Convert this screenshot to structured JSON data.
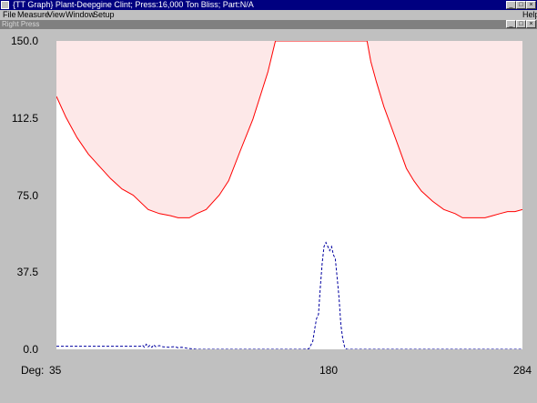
{
  "window": {
    "title": "{TT Graph} Plant-Deepgine Clint; Press:16,000 Ton Bliss; Part:N/A",
    "menu": [
      "File",
      "Measure",
      "View",
      "Window",
      "Setup"
    ],
    "help_label": "Help",
    "child_title": "Right Press"
  },
  "axis": {
    "x_prefix": "Deg:",
    "x_ticks": [
      "35",
      "180",
      "284"
    ]
  },
  "chart_data": {
    "type": "line",
    "x_range": [
      35,
      284
    ],
    "ylim": [
      0,
      150
    ],
    "y_ticks": [
      "150.0",
      "112.5",
      "75.0",
      "37.5",
      "0.0"
    ],
    "grid": false,
    "legend": "none",
    "colors": {
      "limit": "#ff0000",
      "limit_fill": "#fde8e8",
      "signal": "#0000a0"
    },
    "series": [
      {
        "style": "solid-red-limit-shaded-above",
        "x": [
          35,
          40,
          46,
          52,
          58,
          64,
          70,
          76,
          84,
          90,
          96,
          100,
          106,
          110,
          115,
          122,
          127,
          133,
          140,
          148,
          152,
          156,
          160,
          168,
          175,
          180,
          186,
          192,
          198,
          201,
          203,
          206,
          210,
          216,
          222,
          226,
          230,
          236,
          242,
          248,
          252,
          256,
          260,
          264,
          268,
          272,
          276,
          280,
          284
        ],
        "values": [
          123,
          113,
          103,
          95,
          89,
          83,
          78,
          75,
          68,
          66,
          65,
          64,
          64,
          66,
          68,
          75,
          82,
          96,
          112,
          135,
          150,
          150,
          150,
          150,
          150,
          150,
          150,
          150,
          150,
          150,
          140,
          130,
          118,
          103,
          88,
          82,
          77,
          72,
          68,
          66,
          64,
          64,
          64,
          64,
          65,
          66,
          67,
          67,
          68
        ]
      },
      {
        "style": "dashed-blue-signal",
        "x": [
          35,
          50,
          70,
          80,
          81,
          82,
          83,
          84,
          85,
          86,
          87,
          88,
          90,
          92,
          95,
          98,
          100,
          102,
          105,
          110,
          120,
          130,
          140,
          150,
          160,
          167,
          170,
          172,
          173,
          174,
          175,
          176,
          177,
          178,
          179,
          180,
          181,
          182,
          183,
          184,
          185,
          186,
          187,
          188,
          189,
          190,
          192,
          195,
          200,
          210,
          220,
          230,
          240,
          250,
          260,
          270,
          280,
          284
        ],
        "values": [
          1.5,
          1.5,
          1.5,
          1.5,
          2.0,
          1.0,
          2.5,
          1.2,
          2.0,
          1.0,
          2.2,
          1.3,
          1.8,
          1.2,
          1.0,
          1.3,
          0.8,
          1.0,
          0.5,
          0.0,
          0.0,
          0.0,
          0.0,
          0.0,
          0.0,
          0.0,
          0.3,
          4.0,
          10.0,
          15.0,
          17.0,
          30.0,
          42.0,
          50.0,
          52.0,
          50.0,
          48.0,
          50.0,
          46.0,
          44.0,
          35.0,
          25.0,
          12.0,
          5.0,
          1.0,
          0.0,
          0.0,
          0.0,
          0.0,
          0.0,
          0.0,
          0.0,
          0.0,
          0.0,
          0.0,
          0.0,
          0.0,
          0.0
        ]
      }
    ]
  }
}
